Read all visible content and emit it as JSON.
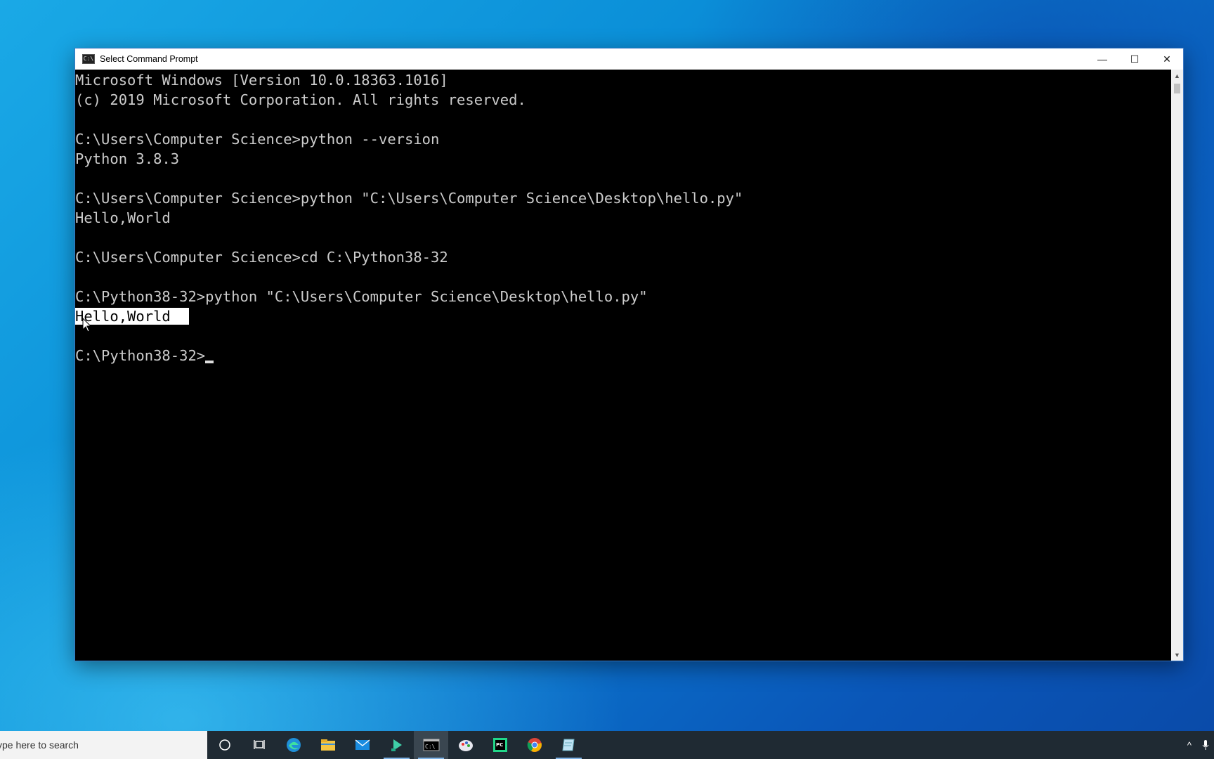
{
  "window": {
    "title": "Select Command Prompt",
    "icon_label": "C:\\",
    "controls": {
      "minimize": "—",
      "maximize": "☐",
      "close": "✕"
    }
  },
  "console": {
    "lines": [
      "Microsoft Windows [Version 10.0.18363.1016]",
      "(c) 2019 Microsoft Corporation. All rights reserved.",
      "",
      "C:\\Users\\Computer Science>python --version",
      "Python 3.8.3",
      "",
      "C:\\Users\\Computer Science>python \"C:\\Users\\Computer Science\\Desktop\\hello.py\"",
      "Hello,World",
      "",
      "C:\\Users\\Computer Science>cd C:\\Python38-32",
      "",
      "C:\\Python38-32>python \"C:\\Users\\Computer Science\\Desktop\\hello.py\""
    ],
    "selected_line": "Hello,World",
    "prompt": "C:\\Python38-32>"
  },
  "taskbar": {
    "search_placeholder": "ype here to search",
    "items": [
      {
        "name": "cortana-icon",
        "glyph": "○"
      },
      {
        "name": "task-view-icon",
        "glyph": "⧉"
      },
      {
        "name": "edge-icon",
        "glyph": "e"
      },
      {
        "name": "file-explorer-icon",
        "glyph": "▬"
      },
      {
        "name": "mail-icon",
        "glyph": "✉"
      },
      {
        "name": "app-icon",
        "glyph": "◆"
      },
      {
        "name": "command-prompt-icon",
        "glyph": "C:\\"
      },
      {
        "name": "paint-icon",
        "glyph": "✿"
      },
      {
        "name": "pycharm-icon",
        "glyph": "PC"
      },
      {
        "name": "chrome-icon",
        "glyph": "●"
      },
      {
        "name": "notepad-icon",
        "glyph": "▤"
      }
    ],
    "tray": {
      "chevron": "^",
      "mic": "🎙"
    }
  },
  "colors": {
    "console_bg": "#000000",
    "console_fg": "#cccccc",
    "taskbar_bg": "#1f2a33",
    "accent": "#0a78d7"
  }
}
